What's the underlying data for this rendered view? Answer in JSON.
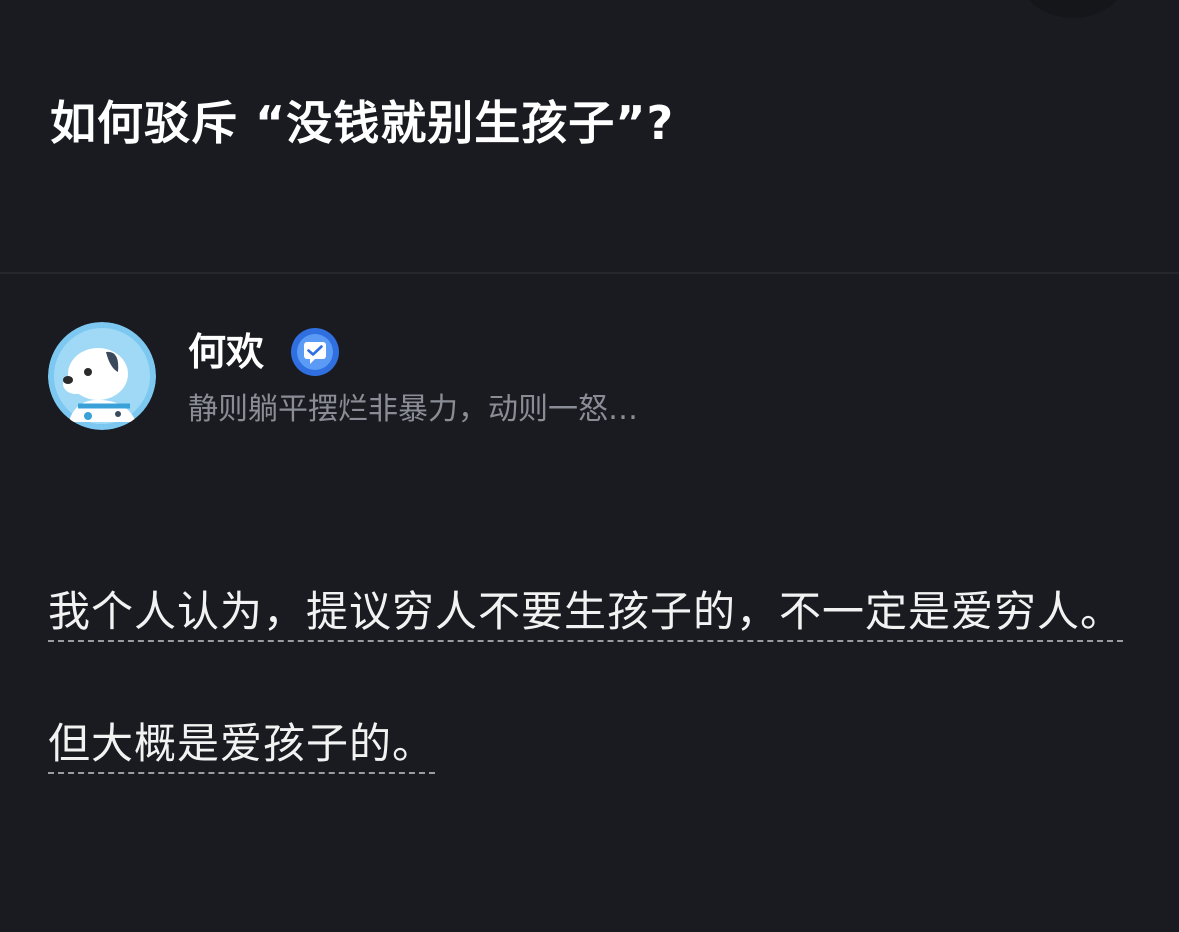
{
  "question": {
    "title": "如何驳斥 “没钱就别生孩子”?"
  },
  "author": {
    "name": "何欢",
    "bio": "静则躺平摆烂非暴力，动则一怒…",
    "verified_icon": "verified-message-icon",
    "accent_color": "#3b82f6"
  },
  "answer": {
    "paragraphs": [
      "我个人认为，提议穷人不要生孩子的，不一定是爱穷人。",
      "但大概是爱孩子的。"
    ]
  }
}
